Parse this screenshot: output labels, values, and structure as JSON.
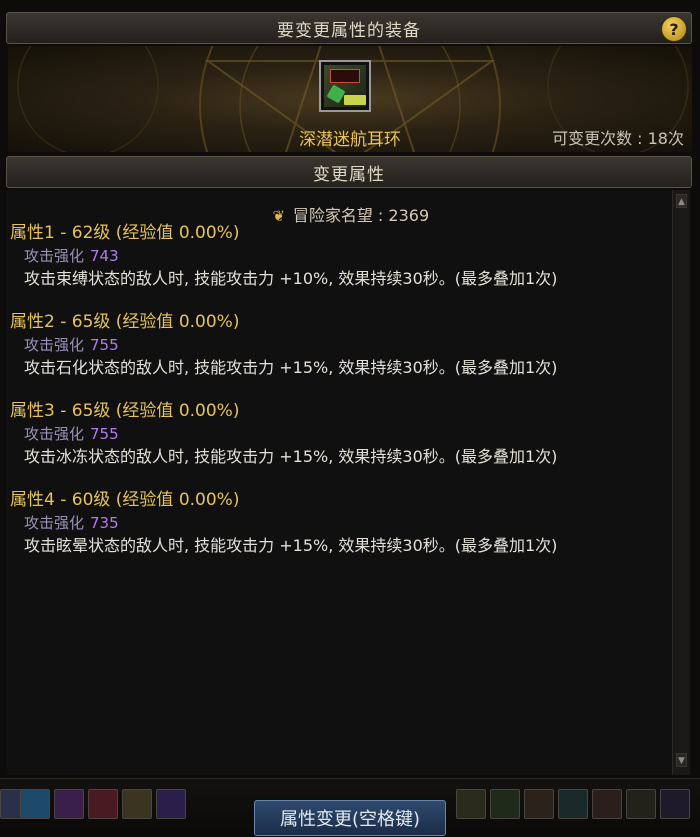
{
  "window": {
    "title": "要变更属性的装备",
    "help_symbol": "?"
  },
  "item": {
    "icon_name": "earring-item-icon",
    "name": "深潜迷航耳环",
    "change_count": "可变更次数 : 18次"
  },
  "section": {
    "title": "变更属性"
  },
  "reputation": {
    "label": "冒险家名望 : 2369"
  },
  "attributes": [
    {
      "title": "属性1 - 62级 (经验值 0.00%)",
      "stat_label": "攻击强化",
      "stat_value": "743",
      "description": "攻击束缚状态的敌人时, 技能攻击力 +10%, 效果持续30秒。(最多叠加1次)"
    },
    {
      "title": "属性2 - 65级 (经验值 0.00%)",
      "stat_label": "攻击强化",
      "stat_value": "755",
      "description": "攻击石化状态的敌人时, 技能攻击力 +15%, 效果持续30秒。(最多叠加1次)"
    },
    {
      "title": "属性3 - 65级 (经验值 0.00%)",
      "stat_label": "攻击强化",
      "stat_value": "755",
      "description": "攻击冰冻状态的敌人时, 技能攻击力 +15%, 效果持续30秒。(最多叠加1次)"
    },
    {
      "title": "属性4 - 60级 (经验值 0.00%)",
      "stat_label": "攻击强化",
      "stat_value": "735",
      "description": "攻击眩晕状态的敌人时, 技能攻击力 +15%, 效果持续30秒。(最多叠加1次)"
    }
  ],
  "footer": {
    "button_label": "属性变更(空格键)"
  },
  "colors": {
    "gold_text": "#e6c35c",
    "purple_value": "#b07cf0",
    "button_blue": "#2f4a6e"
  }
}
